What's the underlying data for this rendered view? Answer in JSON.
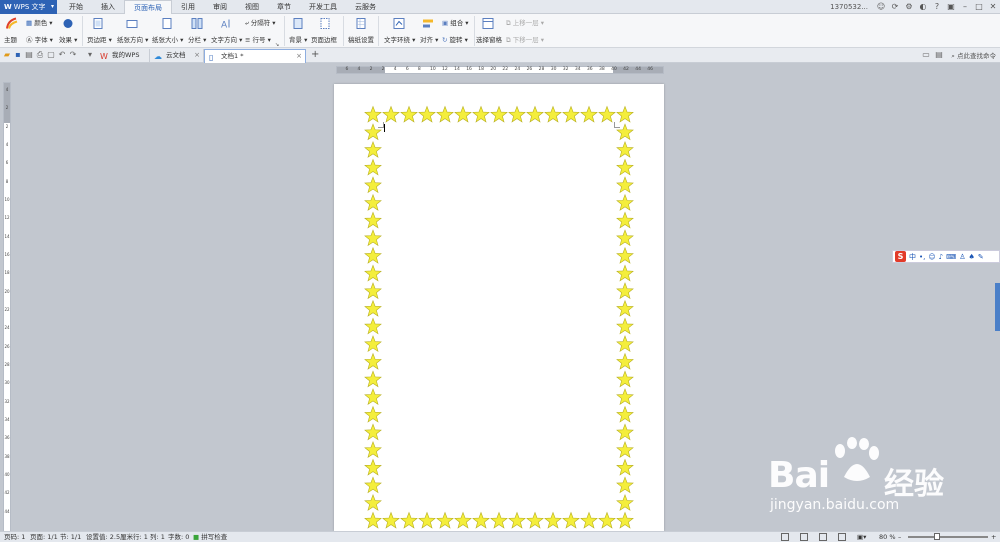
{
  "app": {
    "name": "WPS 文字",
    "logo": "W",
    "user": "1370532..."
  },
  "menu": [
    "开始",
    "插入",
    "页面布局",
    "引用",
    "审阅",
    "视图",
    "章节",
    "开发工具",
    "云服务"
  ],
  "menu_active": "页面布局",
  "ribbon": {
    "theme": "主题",
    "color": "颜色",
    "font": "字体",
    "effect": "效果",
    "margins": "页边距",
    "orientation": "纸张方向",
    "size": "纸张大小",
    "columns": "分栏",
    "text_direction": "文字方向",
    "breaks": "分隔符",
    "line_numbers": "行号",
    "background": "背景",
    "page_border": "页面边框",
    "draft_settings": "稿纸设置",
    "text_wrap": "文字环绕",
    "align": "对齐",
    "group": "组合",
    "rotate": "旋转",
    "selection_pane": "选择窗格",
    "bring_forward": "上移一层",
    "send_backward": "下移一层"
  },
  "tabs": {
    "my_wps": "我的WPS",
    "cloud_docs": "云文档",
    "doc1": "文档1 *"
  },
  "search_command": "点此查找命令",
  "ruler_h": [
    "6",
    "4",
    "2",
    "2",
    "4",
    "6",
    "8",
    "10",
    "12",
    "14",
    "16",
    "18",
    "20",
    "22",
    "24",
    "26",
    "28",
    "30",
    "32",
    "34",
    "36",
    "38",
    "40",
    "42",
    "44",
    "46"
  ],
  "ruler_v": [
    "4",
    "2",
    "2",
    "4",
    "6",
    "8",
    "10",
    "12",
    "14",
    "16",
    "18",
    "20",
    "22",
    "24",
    "26",
    "28",
    "30",
    "32",
    "34",
    "36",
    "38",
    "40",
    "42",
    "44"
  ],
  "ime": {
    "logo": "S",
    "lang": "中"
  },
  "watermark": {
    "main": "Bai",
    "brand": "经验",
    "url": "jingyan.baidu.com"
  },
  "status": {
    "page_code": "页码: 1",
    "pages": "页面: 1/1",
    "section": "节: 1/1",
    "setting": "设置值: 2.5厘米",
    "row": "行: 1",
    "col": "列: 1",
    "words": "字数: 0",
    "spell": "拼写检查",
    "zoom": "80 %"
  },
  "colors": {
    "accent": "#2e63b5",
    "star_fill": "#f4ee3c",
    "star_stroke": "#b8b020"
  }
}
